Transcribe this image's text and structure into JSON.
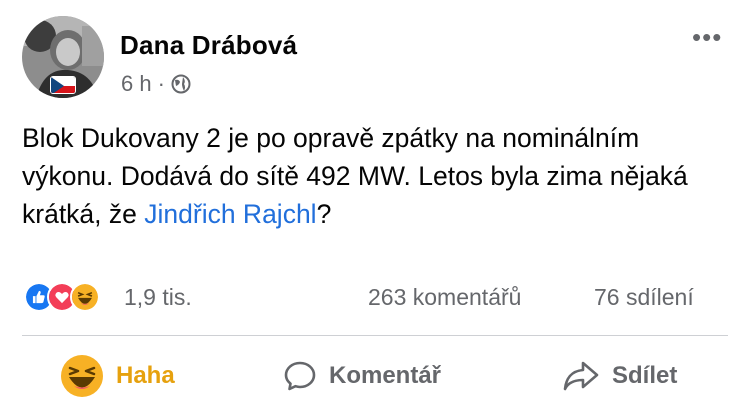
{
  "post": {
    "author": "Dana Drábová",
    "time": "6 h",
    "separator": "·",
    "privacy_icon": "globe-icon",
    "more_icon": "more-options-icon",
    "text_before": "Blok Dukovany 2 je po opravě zpátky na nominálním výkonu. Dodává do sítě 492 MW. Letos byla zima nějaká krátká, že ",
    "mention": "Jindřich Rajchl",
    "text_after": "?"
  },
  "stats": {
    "reaction_icons": [
      "like-icon",
      "love-icon",
      "haha-icon"
    ],
    "reactions": "1,9 tis.",
    "comments": "263 komentářů",
    "shares": "76 sdílení"
  },
  "actions": {
    "haha": "Haha",
    "comment": "Komentář",
    "share": "Sdílet"
  },
  "colors": {
    "mention": "#216fdb",
    "muted": "#65676b",
    "haha": "#e6a10e",
    "like": "#1877f2",
    "love": "#f33e58"
  }
}
